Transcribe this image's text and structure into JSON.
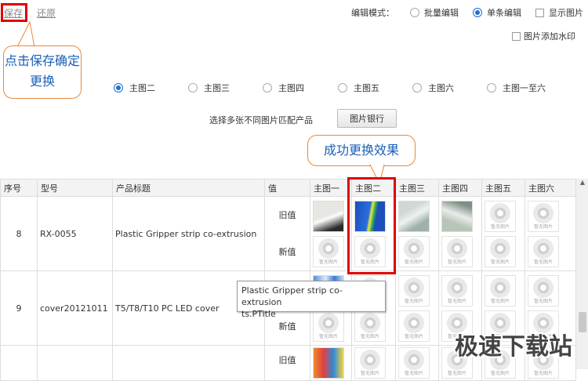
{
  "toolbar": {
    "save_label": "保存",
    "restore_label": "还原",
    "edit_mode_label": "编辑模式：",
    "batch_edit_label": "批量编辑",
    "single_edit_label": "单条编辑",
    "show_image_label": "显示图片",
    "edit_mode_selected": "单条编辑"
  },
  "watermark_option_label": "图片添加水印",
  "image_slots": {
    "selected": "主图二",
    "options": [
      "主图二",
      "主图三",
      "主图四",
      "主图五",
      "主图六",
      "主图一至六"
    ]
  },
  "multi_select_hint": "选择多张不同图片匹配产品",
  "image_bank_button": "图片银行",
  "callouts": {
    "save_tip": "点击保存确定更换",
    "success_tip": "成功更换效果"
  },
  "table": {
    "headers": [
      "序号",
      "型号",
      "产品标题",
      "值",
      "主图一",
      "主图二",
      "主图三",
      "主图四",
      "主图五",
      "主图六"
    ],
    "old_value_label": "旧值",
    "new_value_label": "新值",
    "placeholder_caption": "暂无图片",
    "rows": [
      {
        "index": "8",
        "model": "RX-0055",
        "title": "Plastic Gripper strip co-extrusion"
      },
      {
        "index": "9",
        "model": "cover20121011",
        "title": "T5/T8/T10 PC LED cover"
      },
      {
        "index": "",
        "model": "",
        "title": ""
      }
    ]
  },
  "tooltip": {
    "line1": "Plastic Gripper strip co-extrusion",
    "line2": "ts.PTitle"
  },
  "site_watermark": "极速下载站",
  "colors": {
    "accent": "#1f6fd1",
    "highlight_border": "#e00000",
    "callout_border": "#e8883a",
    "callout_text": "#1a5fb4"
  }
}
